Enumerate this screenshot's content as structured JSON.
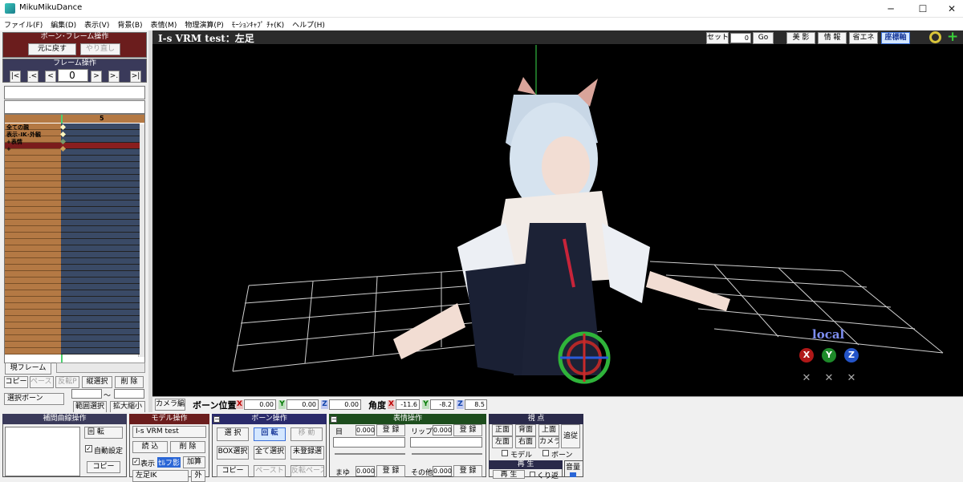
{
  "window": {
    "title": "MikuMikuDance",
    "minimize": "─",
    "maximize": "☐",
    "close": "✕"
  },
  "menu": [
    "ファイル(F)",
    "編集(D)",
    "表示(V)",
    "背景(B)",
    "表情(M)",
    "物理演算(P)",
    "ﾓｰｼｮﾝｷｬﾌﾟ ﾁｬ(K)",
    "ヘルプ(H)"
  ],
  "bone_frame_ops": {
    "header": "ボーン･フレーム操作",
    "undo": "元に戻す",
    "redo": "やり直し"
  },
  "frame_ops": {
    "header": "フレーム操作",
    "first": "|<",
    "prev_key": ".<",
    "prev": "<",
    "frame": "0",
    "next": ">",
    "next_key": ">.",
    "last": ">|"
  },
  "timeline": {
    "ruler_mark": "5",
    "rows": [
      "全ての親",
      "表示･IK･外観",
      "+表情",
      "+"
    ],
    "current_frame_btn": "現フレーム"
  },
  "timeline_tools": {
    "copy": "コピー",
    "paste": "ペースト",
    "reverse_paste": "反転P",
    "vertical_select": "縦選択",
    "delete": "削 除",
    "select_bone": "選択ボーン",
    "tilde": "～",
    "range_select": "範囲選択",
    "zoom": "拡大縮小"
  },
  "viewport": {
    "title": "I-s VRM test：左足",
    "set_label": "セット",
    "frame_value": "0",
    "go": "Go",
    "beauty": "美 影",
    "info": "情 報",
    "eco": "省エネ",
    "axis": "座標軸",
    "local_label": "local",
    "x": "X",
    "y": "Y",
    "z": "Z"
  },
  "bone_bar": {
    "camera_edit": "カメラ編",
    "pos_label": "ボーン位置",
    "x_label": "X",
    "pos_x": "0.00",
    "y_label": "Y",
    "pos_y": "0.00",
    "z_label": "Z",
    "pos_z": "0.00",
    "angle_label": "角度",
    "ang_x": "-11.6",
    "ang_y": "-8.2",
    "ang_z": "8.5"
  },
  "interp": {
    "header": "補間曲線操作",
    "mode": "回 転",
    "auto": "自動設定",
    "copy": "コピー"
  },
  "model_ops": {
    "header": "モデル操作",
    "model": "I-s VRM test",
    "load": "読 込",
    "delete": "削 除",
    "show": "表示",
    "shadow": "ｾﾙフ影",
    "add": "加算",
    "bone_sel": "左足IK",
    "outer": "外"
  },
  "bone_ops": {
    "header": "ボーン操作",
    "select": "選 択",
    "rotate": "回 転",
    "move": "移 動",
    "box_select": "BOX選択",
    "select_all": "全て選択",
    "unregistered": "未登録選",
    "copy": "コピー",
    "paste": "ペースト",
    "rev_paste": "反転ペースト"
  },
  "morph_ops": {
    "header": "表情操作",
    "eye": "目",
    "eye_val": "0.000",
    "register": "登 録",
    "lip": "リップ",
    "lip_val": "0.000",
    "brow": "まゆ",
    "brow_val": "0.000",
    "other": "その他",
    "other_val": "0.000"
  },
  "view_ops": {
    "header": "視 点",
    "front": "正面",
    "back": "背面",
    "top": "上面",
    "left": "左面",
    "right": "右面",
    "camera": "カメラ",
    "follow": "追従",
    "model": "モデル",
    "bone": "ボーン"
  },
  "playback": {
    "header": "再 生",
    "play": "再 生",
    "repeat": "くり返",
    "volume": "音量"
  },
  "colors": {
    "section_header": "#3a3a5a",
    "model_header": "#6b1d1d",
    "morph_header": "#1d4d1d",
    "bone_header": "#2a2a6a",
    "view_header": "#2a2a4a"
  }
}
